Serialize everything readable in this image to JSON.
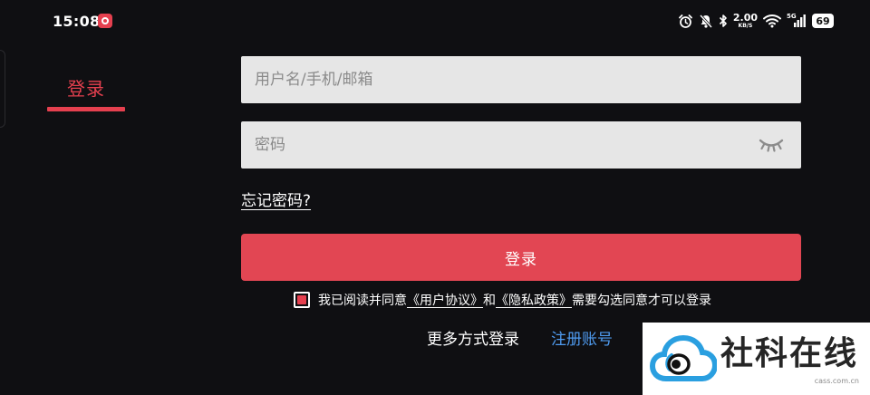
{
  "status_bar": {
    "time": "15:08",
    "net_speed_value": "2.00",
    "net_speed_unit": "KB/S",
    "network_label": "5G",
    "battery": "69",
    "icons": [
      "app-icon",
      "alarm-icon",
      "mute-icon",
      "bluetooth-icon",
      "wifi-icon",
      "signal-icon",
      "battery-icon"
    ]
  },
  "tabs": {
    "login_label": "登录"
  },
  "form": {
    "username_placeholder": "用户名/手机/邮箱",
    "password_placeholder": "密码",
    "eye_icon": "eye-closed-icon",
    "forgot_label": "忘记密码?",
    "login_button_label": "登录"
  },
  "agreement": {
    "prefix": "我已阅读并同意",
    "user_agreement": "《用户协议》",
    "and": "和",
    "privacy_policy": "《隐私政策》",
    "suffix": "需要勾选同意才可以登录"
  },
  "footer": {
    "more_login": "更多方式登录",
    "register": "注册账号"
  },
  "watermark": {
    "text": "社科在线",
    "domain": "cass.com.cn"
  },
  "colors": {
    "accent": "#e5404f",
    "button": "#e24653",
    "link_blue": "#4f9bf0",
    "input_bg": "#e6e6e6",
    "background": "#0f0f12"
  }
}
